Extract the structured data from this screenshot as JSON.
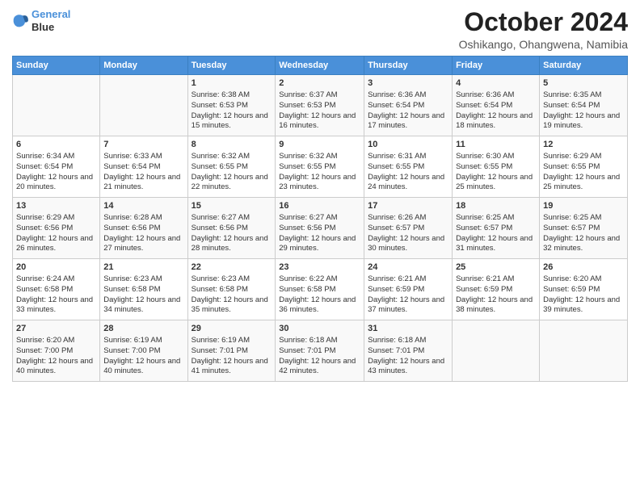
{
  "header": {
    "logo_line1": "General",
    "logo_line2": "Blue",
    "title": "October 2024",
    "subtitle": "Oshikango, Ohangwena, Namibia"
  },
  "days_of_week": [
    "Sunday",
    "Monday",
    "Tuesday",
    "Wednesday",
    "Thursday",
    "Friday",
    "Saturday"
  ],
  "weeks": [
    [
      {
        "day": "",
        "info": ""
      },
      {
        "day": "",
        "info": ""
      },
      {
        "day": "1",
        "info": "Sunrise: 6:38 AM\nSunset: 6:53 PM\nDaylight: 12 hours and 15 minutes."
      },
      {
        "day": "2",
        "info": "Sunrise: 6:37 AM\nSunset: 6:53 PM\nDaylight: 12 hours and 16 minutes."
      },
      {
        "day": "3",
        "info": "Sunrise: 6:36 AM\nSunset: 6:54 PM\nDaylight: 12 hours and 17 minutes."
      },
      {
        "day": "4",
        "info": "Sunrise: 6:36 AM\nSunset: 6:54 PM\nDaylight: 12 hours and 18 minutes."
      },
      {
        "day": "5",
        "info": "Sunrise: 6:35 AM\nSunset: 6:54 PM\nDaylight: 12 hours and 19 minutes."
      }
    ],
    [
      {
        "day": "6",
        "info": "Sunrise: 6:34 AM\nSunset: 6:54 PM\nDaylight: 12 hours and 20 minutes."
      },
      {
        "day": "7",
        "info": "Sunrise: 6:33 AM\nSunset: 6:54 PM\nDaylight: 12 hours and 21 minutes."
      },
      {
        "day": "8",
        "info": "Sunrise: 6:32 AM\nSunset: 6:55 PM\nDaylight: 12 hours and 22 minutes."
      },
      {
        "day": "9",
        "info": "Sunrise: 6:32 AM\nSunset: 6:55 PM\nDaylight: 12 hours and 23 minutes."
      },
      {
        "day": "10",
        "info": "Sunrise: 6:31 AM\nSunset: 6:55 PM\nDaylight: 12 hours and 24 minutes."
      },
      {
        "day": "11",
        "info": "Sunrise: 6:30 AM\nSunset: 6:55 PM\nDaylight: 12 hours and 25 minutes."
      },
      {
        "day": "12",
        "info": "Sunrise: 6:29 AM\nSunset: 6:55 PM\nDaylight: 12 hours and 25 minutes."
      }
    ],
    [
      {
        "day": "13",
        "info": "Sunrise: 6:29 AM\nSunset: 6:56 PM\nDaylight: 12 hours and 26 minutes."
      },
      {
        "day": "14",
        "info": "Sunrise: 6:28 AM\nSunset: 6:56 PM\nDaylight: 12 hours and 27 minutes."
      },
      {
        "day": "15",
        "info": "Sunrise: 6:27 AM\nSunset: 6:56 PM\nDaylight: 12 hours and 28 minutes."
      },
      {
        "day": "16",
        "info": "Sunrise: 6:27 AM\nSunset: 6:56 PM\nDaylight: 12 hours and 29 minutes."
      },
      {
        "day": "17",
        "info": "Sunrise: 6:26 AM\nSunset: 6:57 PM\nDaylight: 12 hours and 30 minutes."
      },
      {
        "day": "18",
        "info": "Sunrise: 6:25 AM\nSunset: 6:57 PM\nDaylight: 12 hours and 31 minutes."
      },
      {
        "day": "19",
        "info": "Sunrise: 6:25 AM\nSunset: 6:57 PM\nDaylight: 12 hours and 32 minutes."
      }
    ],
    [
      {
        "day": "20",
        "info": "Sunrise: 6:24 AM\nSunset: 6:58 PM\nDaylight: 12 hours and 33 minutes."
      },
      {
        "day": "21",
        "info": "Sunrise: 6:23 AM\nSunset: 6:58 PM\nDaylight: 12 hours and 34 minutes."
      },
      {
        "day": "22",
        "info": "Sunrise: 6:23 AM\nSunset: 6:58 PM\nDaylight: 12 hours and 35 minutes."
      },
      {
        "day": "23",
        "info": "Sunrise: 6:22 AM\nSunset: 6:58 PM\nDaylight: 12 hours and 36 minutes."
      },
      {
        "day": "24",
        "info": "Sunrise: 6:21 AM\nSunset: 6:59 PM\nDaylight: 12 hours and 37 minutes."
      },
      {
        "day": "25",
        "info": "Sunrise: 6:21 AM\nSunset: 6:59 PM\nDaylight: 12 hours and 38 minutes."
      },
      {
        "day": "26",
        "info": "Sunrise: 6:20 AM\nSunset: 6:59 PM\nDaylight: 12 hours and 39 minutes."
      }
    ],
    [
      {
        "day": "27",
        "info": "Sunrise: 6:20 AM\nSunset: 7:00 PM\nDaylight: 12 hours and 40 minutes."
      },
      {
        "day": "28",
        "info": "Sunrise: 6:19 AM\nSunset: 7:00 PM\nDaylight: 12 hours and 40 minutes."
      },
      {
        "day": "29",
        "info": "Sunrise: 6:19 AM\nSunset: 7:01 PM\nDaylight: 12 hours and 41 minutes."
      },
      {
        "day": "30",
        "info": "Sunrise: 6:18 AM\nSunset: 7:01 PM\nDaylight: 12 hours and 42 minutes."
      },
      {
        "day": "31",
        "info": "Sunrise: 6:18 AM\nSunset: 7:01 PM\nDaylight: 12 hours and 43 minutes."
      },
      {
        "day": "",
        "info": ""
      },
      {
        "day": "",
        "info": ""
      }
    ]
  ]
}
